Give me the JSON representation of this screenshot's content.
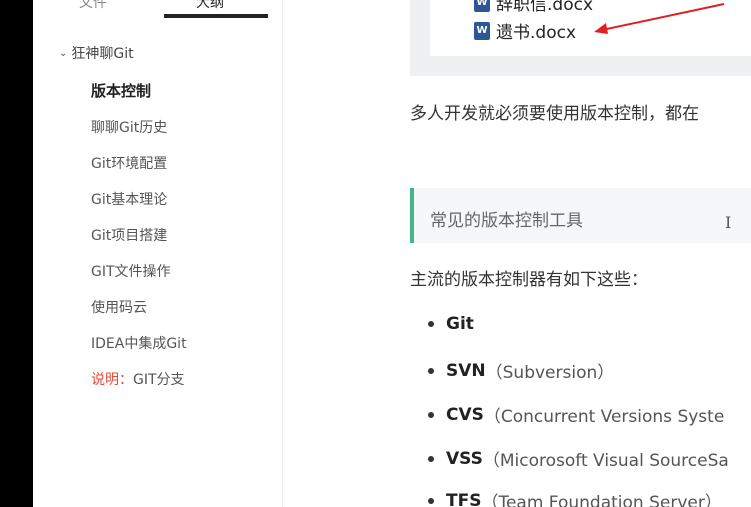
{
  "sidebar": {
    "tabs": [
      {
        "label": "文件"
      },
      {
        "label": "大纲"
      }
    ],
    "root": {
      "label": "狂神聊Git"
    },
    "items": [
      {
        "label": "版本控制"
      },
      {
        "label": "聊聊Git历史"
      },
      {
        "label": "Git环境配置"
      },
      {
        "label": "Git基本理论"
      },
      {
        "label": "Git项目搭建"
      },
      {
        "label": "GIT文件操作"
      },
      {
        "label": "使用码云"
      },
      {
        "label": "IDEA中集成Git"
      },
      {
        "label_warn": "说明：",
        "label_rest": "GIT分支"
      }
    ]
  },
  "content": {
    "files": [
      {
        "name": "辞职信.docx"
      },
      {
        "name": "遗书.docx"
      }
    ],
    "para1": "多人开发就必须要使用版本控制，都在",
    "quote": "常见的版本控制工具",
    "para2": "主流的版本控制器有如下这些：",
    "tools": [
      {
        "name": "Git",
        "desc": ""
      },
      {
        "name": "SVN",
        "desc": "（Subversion）"
      },
      {
        "name": "CVS",
        "desc": "（Concurrent Versions Syste"
      },
      {
        "name": "VSS",
        "desc": "（Micorosoft Visual SourceSa"
      },
      {
        "name": "TFS",
        "desc": "（Team Foundation Server）"
      }
    ]
  },
  "colors": {
    "accent_green": "#42b983",
    "warn_red": "#e84b3c",
    "arrow_red": "#e02020"
  }
}
